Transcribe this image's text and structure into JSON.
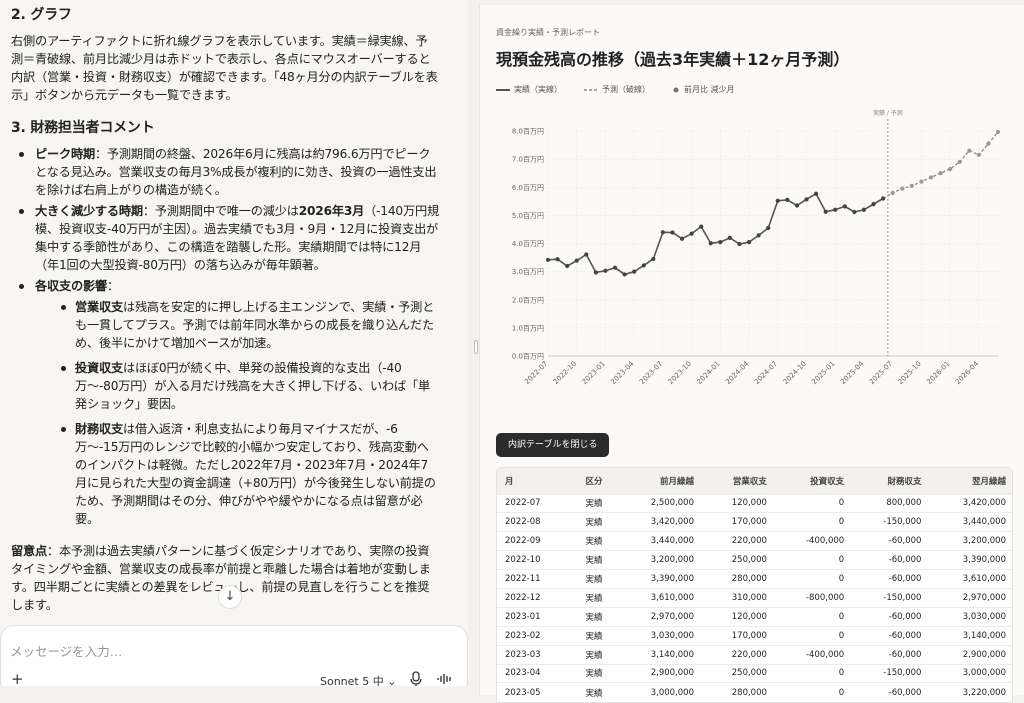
{
  "chat": {
    "sec2_title": "2. グラフ",
    "sec2_body": "右側のアーティファクトに折れ線グラフを表示しています。実績＝緑実線、予測＝青破線、前月比減少月は赤ドットで表示し、各点にマウスオーバーすると内訳（営業・投資・財務収支）が確認できます。「48ヶ月分の内訳テーブルを表示」ボタンから元データも一覧できます。",
    "sec3_title": "3. 財務担当者コメント",
    "b1_head": "ピーク時期",
    "b1_body": "：予測期間の終盤、2026年6月に残高は約796.6万円でピークとなる見込み。営業収支の毎月3%成長が複利的に効き、投資の一過性支出を除けば右肩上がりの構造が続く。",
    "b2_head": "大きく減少する時期",
    "b2_mid1": "：予測期間中で唯一の減少は",
    "b2_bold": "2026年3月",
    "b2_body": "（-140万円規模、投資収支-40万円が主因）。過去実績でも3月・9月・12月に投資支出が集中する季節性があり、この構造を踏襲した形。実績期間では特に12月（年1回の大型投資-80万円）の落ち込みが毎年顕著。",
    "b3_head": "各収支の影響",
    "b3_body": "：",
    "s1_head": "営業収支",
    "s1_body": "は残高を安定的に押し上げる主エンジンで、実績・予測とも一貫してプラス。予測では前年同水準からの成長を織り込んだため、後半にかけて増加ペースが加速。",
    "s2_head": "投資収支",
    "s2_body": "はほぼ0円が続く中、単発の設備投資的な支出（-40万〜-80万円）が入る月だけ残高を大きく押し下げる、いわば「単発ショック」要因。",
    "s3_head": "財務収支",
    "s3_body": "は借入返済・利息支払により毎月マイナスだが、-6万〜-15万円のレンジで比較的小幅かつ安定しており、残高変動へのインパクトは軽微。ただし2022年7月・2023年7月・2024年7月に見られた大型の資金調達（+80万円）が今後発生しない前提のため、予測期間はその分、伸びがやや緩やかになる点は留意が必要。",
    "note_head": "留意点",
    "note_body": "：本予測は過去実績パターンに基づく仮定シナリオであり、実際の投資タイミングや金額、営業収支の成長率が前提と乖離した場合は着地が変動します。四半期ごとに実績との差異をレビューし、前提の見直しを行うことを推奨します。",
    "input_placeholder": "メッセージを入力…",
    "plus": "+",
    "model": "Sonnet 5  中 ⌄"
  },
  "artifact": {
    "subtitle": "資金繰り実績・予測レポート",
    "title": "現預金残高の推移（過去3年実績＋12ヶ月予測）",
    "legend_actual": "実績（実線）",
    "legend_forecast": "予測（破線）",
    "legend_drop": "前月比 減少月",
    "toggle_label": "内訳テーブルを閉じる",
    "colors": {
      "line": "#555555",
      "point": "#444444",
      "forecast_point": "#999999",
      "grid": "#e6e6e6"
    }
  },
  "chart_data": {
    "type": "line",
    "annotation": "実績 / 予測",
    "ylim": [
      0,
      8000000
    ],
    "yticks": [
      "0.0百万円",
      "1.0百万円",
      "2.0百万円",
      "3.0百万円",
      "4.0百万円",
      "5.0百万円",
      "6.0百万円",
      "7.0百万円",
      "8.0百万円"
    ],
    "xticks": [
      "2022-07",
      "2022-10",
      "2023-01",
      "2023-04",
      "2023-07",
      "2023-10",
      "2024-01",
      "2024-04",
      "2024-07",
      "2024-10",
      "2025-01",
      "2025-04",
      "2025-07",
      "2025-10",
      "2026-01",
      "2026-04"
    ],
    "series": [
      {
        "values": [
          3420000,
          3440000,
          3200000,
          3390000,
          3610000,
          2970000,
          3030000,
          3140000,
          2900000,
          3000000,
          3220000,
          3450000,
          4400000,
          4390000,
          4170000,
          4350000,
          4600000,
          4010000,
          4050000,
          4200000,
          3980000,
          4050000,
          4290000,
          4550000,
          5520000,
          5550000,
          5350000,
          5570000,
          5770000,
          5130000,
          5200000,
          5320000,
          5120000,
          5200000,
          5400000,
          5600000
        ]
      },
      {
        "values": [
          5800000,
          5950000,
          6050000,
          6200000,
          6350000,
          6500000,
          6650000,
          6900000,
          7300000,
          7150000,
          7550000,
          7966000
        ]
      }
    ]
  },
  "table": {
    "headers": [
      "月",
      "区分",
      "前月繰越",
      "営業収支",
      "投資収支",
      "財務収支",
      "翌月繰越"
    ],
    "rows": [
      [
        "2022-07",
        "実績",
        "2,500,000",
        "120,000",
        "0",
        "800,000",
        "3,420,000"
      ],
      [
        "2022-08",
        "実績",
        "3,420,000",
        "170,000",
        "0",
        "-150,000",
        "3,440,000"
      ],
      [
        "2022-09",
        "実績",
        "3,440,000",
        "220,000",
        "-400,000",
        "-60,000",
        "3,200,000"
      ],
      [
        "2022-10",
        "実績",
        "3,200,000",
        "250,000",
        "0",
        "-60,000",
        "3,390,000"
      ],
      [
        "2022-11",
        "実績",
        "3,390,000",
        "280,000",
        "0",
        "-60,000",
        "3,610,000"
      ],
      [
        "2022-12",
        "実績",
        "3,610,000",
        "310,000",
        "-800,000",
        "-150,000",
        "2,970,000"
      ],
      [
        "2023-01",
        "実績",
        "2,970,000",
        "120,000",
        "0",
        "-60,000",
        "3,030,000"
      ],
      [
        "2023-02",
        "実績",
        "3,030,000",
        "170,000",
        "0",
        "-60,000",
        "3,140,000"
      ],
      [
        "2023-03",
        "実績",
        "3,140,000",
        "220,000",
        "-400,000",
        "-60,000",
        "2,900,000"
      ],
      [
        "2023-04",
        "実績",
        "2,900,000",
        "250,000",
        "0",
        "-150,000",
        "3,000,000"
      ],
      [
        "2023-05",
        "実績",
        "3,000,000",
        "280,000",
        "0",
        "-60,000",
        "3,220,000"
      ]
    ]
  }
}
